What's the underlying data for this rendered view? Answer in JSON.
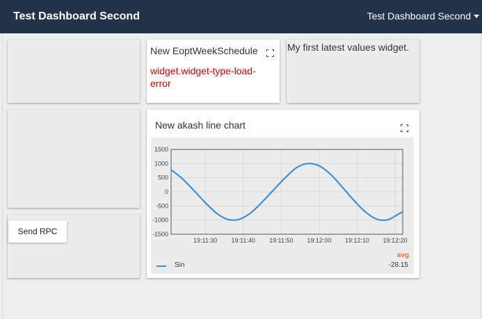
{
  "header": {
    "title": "Test Dashboard Second",
    "dashboard_selector": "Test Dashboard Second"
  },
  "widgets": {
    "eopt": {
      "title": "New EoptWeekSchedule",
      "error": "widget.widget-type-load-error"
    },
    "latest_values": {
      "title": "My first latest values widget."
    },
    "rpc": {
      "button_label": "Send RPC"
    },
    "line_chart": {
      "title": "New akash line chart",
      "legend": {
        "header": "avg",
        "series_name": "Sin",
        "series_avg": "-28.15"
      }
    }
  },
  "chart_data": {
    "type": "line",
    "title": "New akash line chart",
    "xlabel": "",
    "ylabel": "",
    "xlim": [
      "19:11:21",
      "19:12:22"
    ],
    "ylim": [
      -1500,
      1500
    ],
    "yticks": [
      1500,
      1000,
      500,
      0,
      -500,
      -1000,
      -1500
    ],
    "xticks": [
      "19:11:30",
      "19:11:40",
      "19:11:50",
      "19:12:00",
      "19:12:10",
      "19:12:20"
    ],
    "grid": true,
    "legend_position": "bottom",
    "series": [
      {
        "name": "Sin",
        "color": "#3a8fd8",
        "x": [
          "19:11:21",
          "19:11:24",
          "19:11:27",
          "19:11:30",
          "19:11:33",
          "19:11:36",
          "19:11:39",
          "19:11:42",
          "19:11:45",
          "19:11:48",
          "19:11:51",
          "19:11:54",
          "19:11:57",
          "19:12:00",
          "19:12:03",
          "19:12:06",
          "19:12:09",
          "19:12:12",
          "19:12:15",
          "19:12:18",
          "19:12:21",
          "19:12:22"
        ],
        "values": [
          780,
          460,
          50,
          -380,
          -760,
          -980,
          -970,
          -740,
          -360,
          70,
          490,
          850,
          1000,
          920,
          620,
          180,
          -280,
          -690,
          -960,
          -990,
          -780,
          -700
        ]
      }
    ]
  }
}
